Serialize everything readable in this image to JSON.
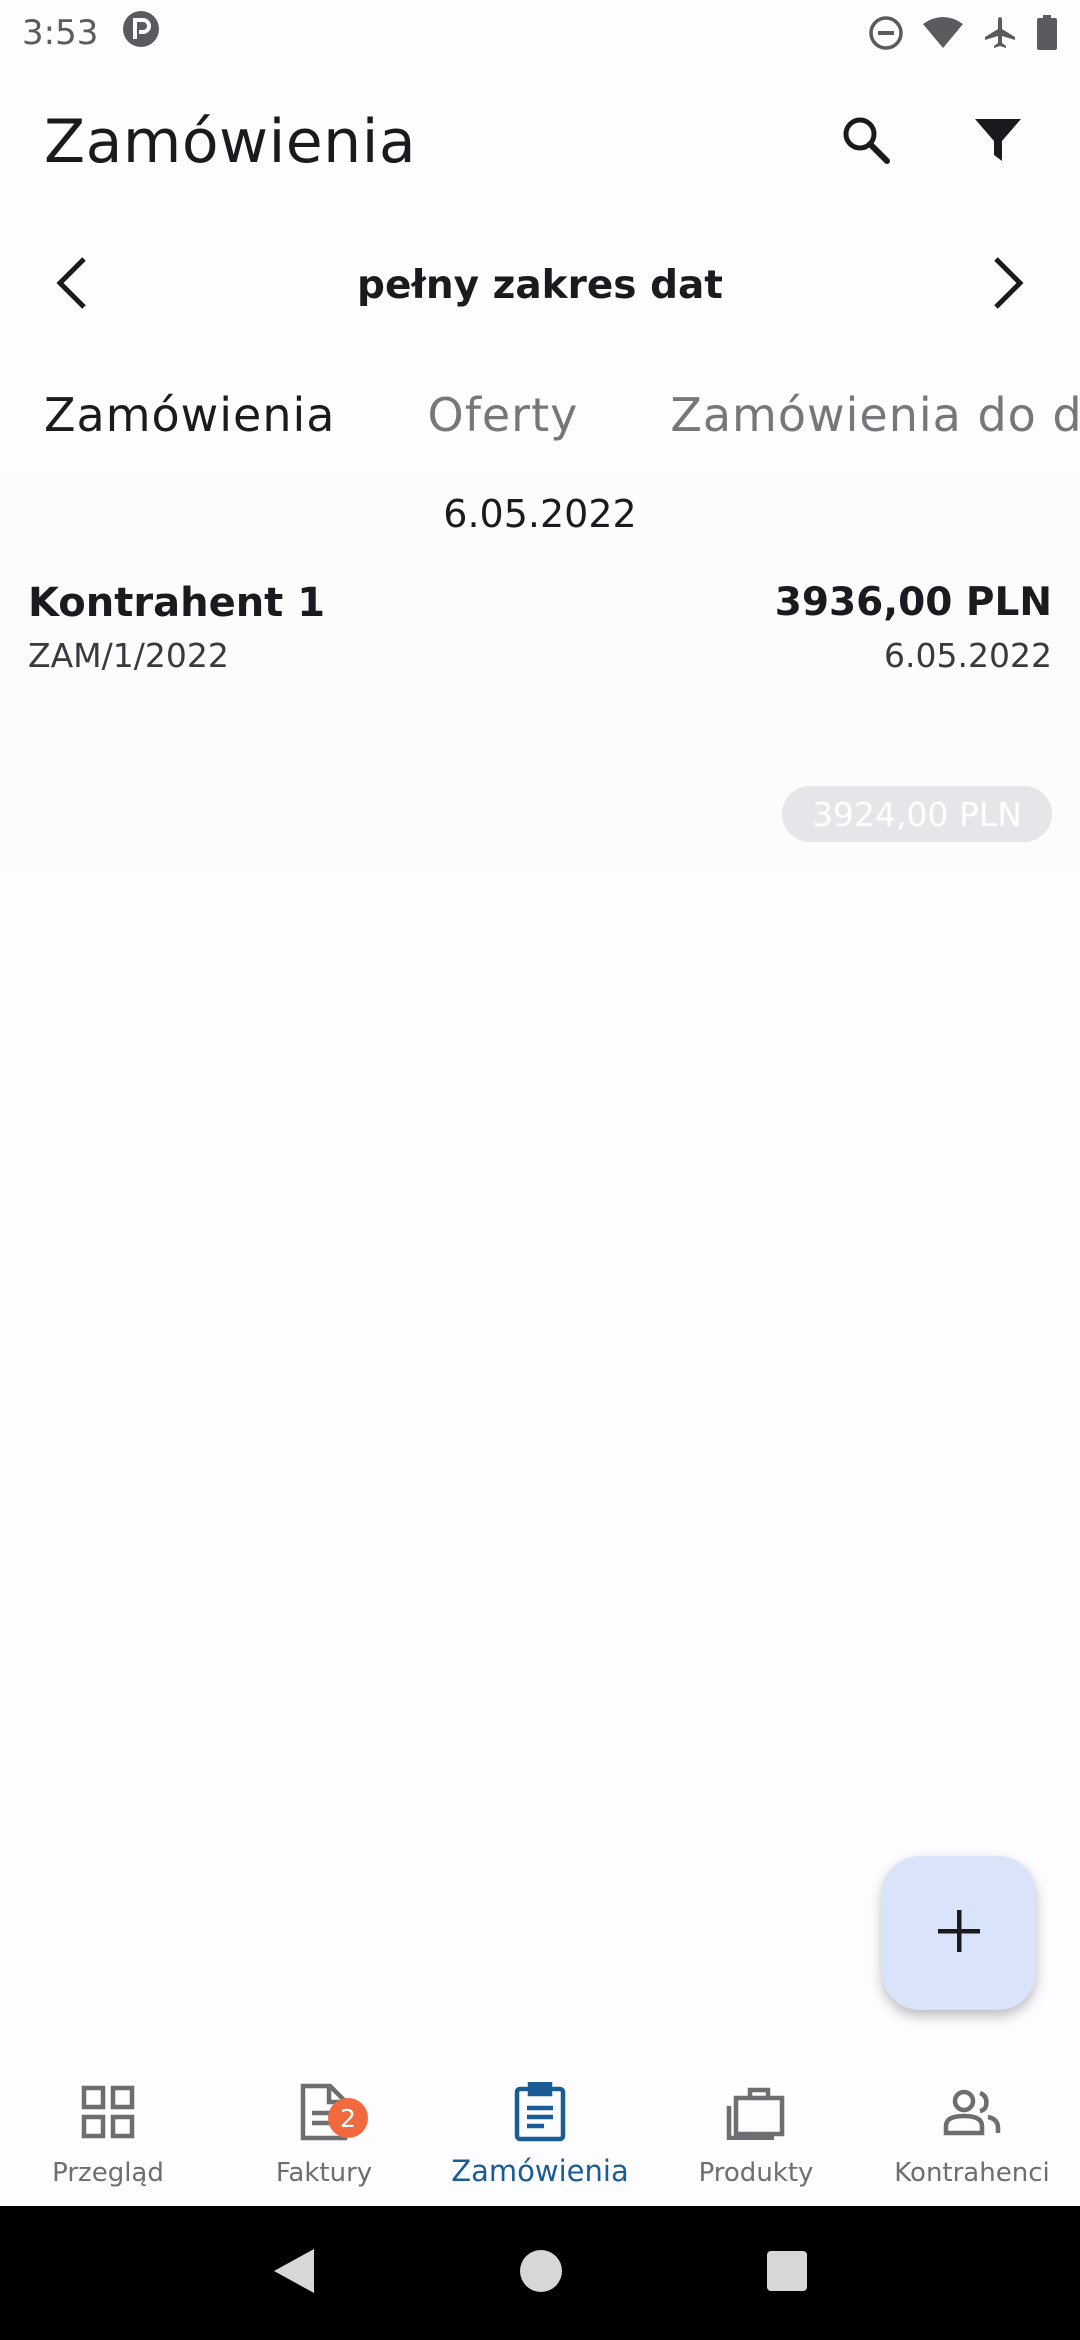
{
  "status_bar": {
    "time": "3:53",
    "icons": [
      "app-notification-icon",
      "do-not-disturb-icon",
      "wifi-icon",
      "airplane-mode-icon",
      "battery-icon"
    ]
  },
  "app_bar": {
    "title": "Zamówienia",
    "actions": [
      "search-icon",
      "filter-icon"
    ]
  },
  "date_range": {
    "label": "pełny zakres dat",
    "prev_icon": "chevron-left-icon",
    "next_icon": "chevron-right-icon"
  },
  "tabs": [
    {
      "label": "Zamówienia",
      "active": true
    },
    {
      "label": "Oferty",
      "active": false
    },
    {
      "label": "Zamówienia do do",
      "active": false
    }
  ],
  "orders_group": {
    "date": "6.05.2022",
    "items": [
      {
        "contractor": "Kontrahent 1",
        "number": "ZAM/1/2022",
        "amount": "3936,00 PLN",
        "date": "6.05.2022"
      }
    ],
    "total": "3924,00 PLN"
  },
  "fab": {
    "icon": "plus-icon"
  },
  "bottom_nav": [
    {
      "label": "Przegląd",
      "icon": "grid-icon",
      "active": false
    },
    {
      "label": "Faktury",
      "icon": "document-icon",
      "active": false,
      "badge": "2"
    },
    {
      "label": "Zamówienia",
      "icon": "clipboard-icon",
      "active": true
    },
    {
      "label": "Produkty",
      "icon": "briefcase-icon",
      "active": false
    },
    {
      "label": "Kontrahenci",
      "icon": "people-icon",
      "active": false
    }
  ],
  "colors": {
    "accent": "#1a5d96",
    "fab_background": "#d9e4fb",
    "badge": "#f2693d",
    "background": "#fdfcff"
  }
}
